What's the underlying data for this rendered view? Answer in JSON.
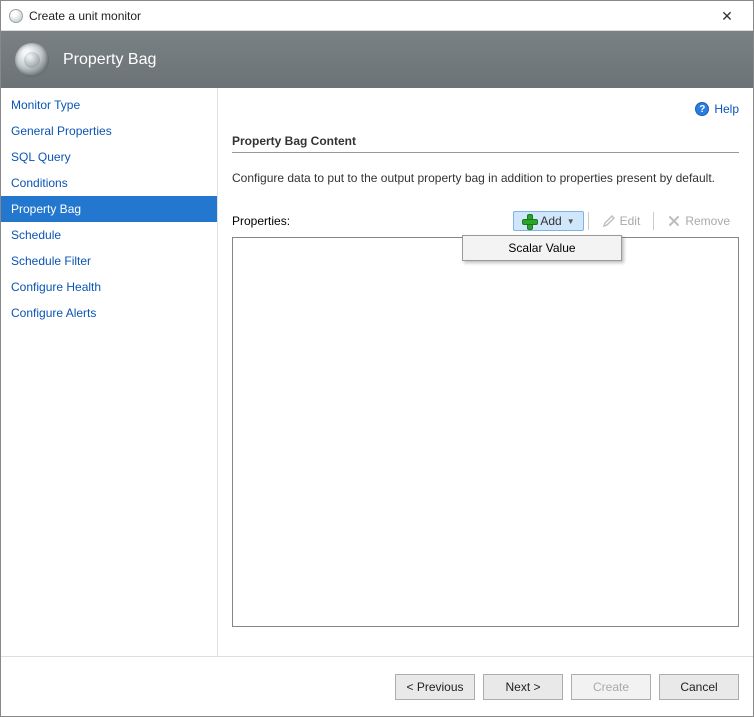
{
  "window": {
    "title": "Create a unit monitor",
    "close_glyph": "✕"
  },
  "header": {
    "title": "Property Bag"
  },
  "sidebar": {
    "items": [
      {
        "label": "Monitor Type"
      },
      {
        "label": "General Properties"
      },
      {
        "label": "SQL Query"
      },
      {
        "label": "Conditions"
      },
      {
        "label": "Property Bag",
        "selected": true
      },
      {
        "label": "Schedule"
      },
      {
        "label": "Schedule Filter"
      },
      {
        "label": "Configure Health"
      },
      {
        "label": "Configure Alerts"
      }
    ]
  },
  "content": {
    "help_label": "Help",
    "section_title": "Property Bag Content",
    "description": "Configure data to put to the output property bag in addition to properties present by default.",
    "properties_label": "Properties:",
    "toolbar": {
      "add_label": "Add",
      "edit_label": "Edit",
      "remove_label": "Remove"
    },
    "dropdown": {
      "items": [
        {
          "label": "Scalar Value"
        }
      ]
    }
  },
  "footer": {
    "previous": "< Previous",
    "next": "Next >",
    "create": "Create",
    "cancel": "Cancel"
  }
}
